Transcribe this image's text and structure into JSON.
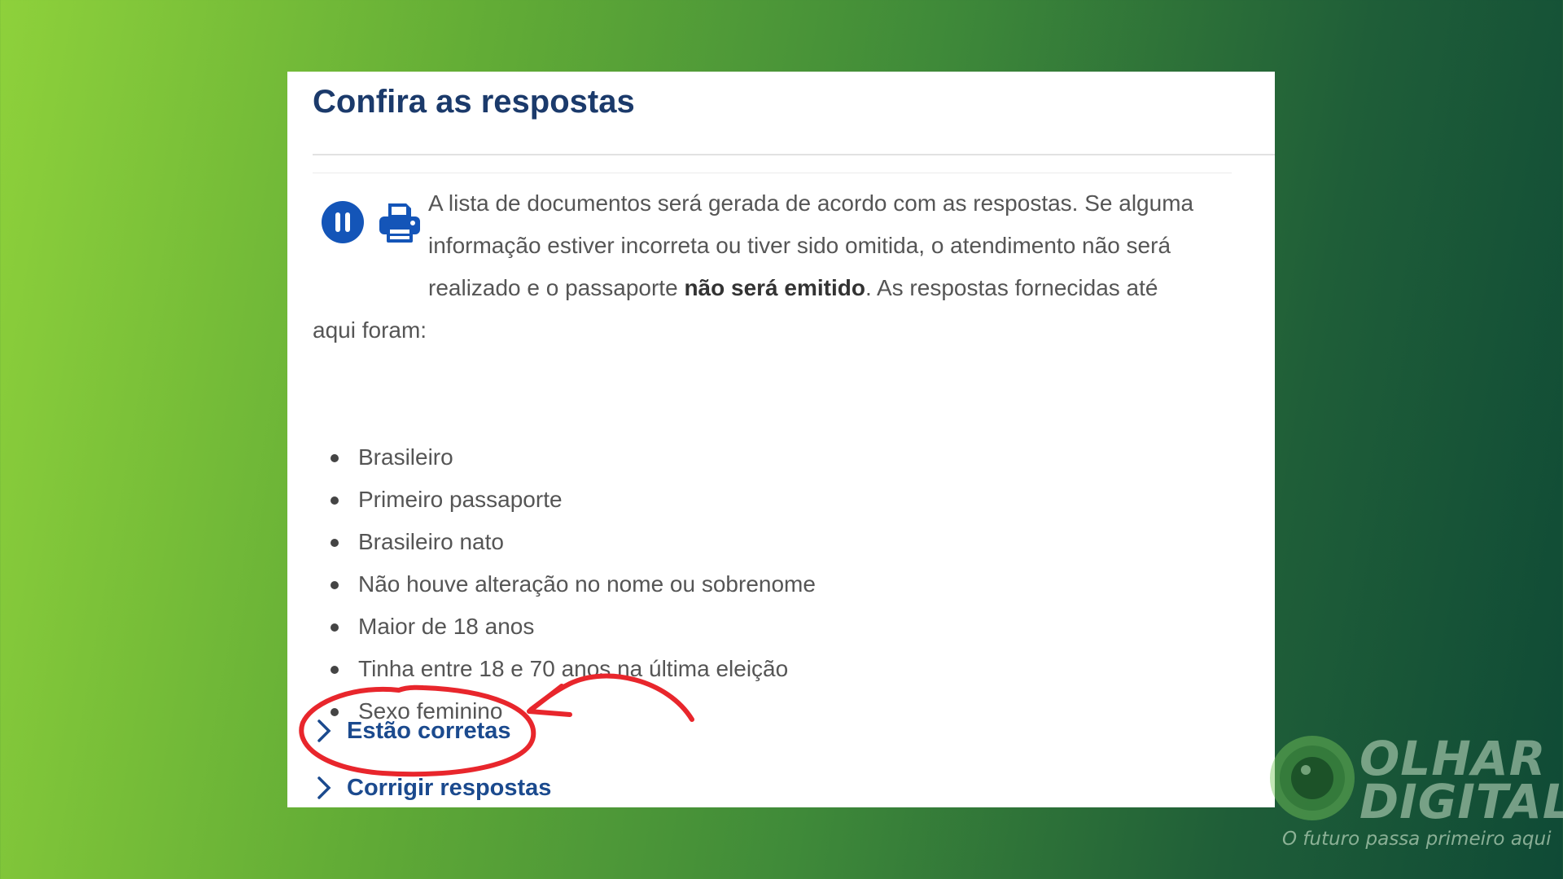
{
  "card": {
    "title": "Confira as respostas",
    "toolbar": {
      "pause_icon": "pause-circle-icon",
      "print_icon": "printer-icon"
    },
    "intro_before": "A lista de documentos será gerada de acordo com as respostas. Se alguma informação estiver incorreta ou tiver sido omitida, o atendimento não será realizado e o passaporte ",
    "intro_bold": "não será emitido",
    "intro_after": ". As respostas fornecidas até aqui foram:",
    "answers": [
      "Brasileiro",
      "Primeiro passaporte",
      "Brasileiro nato",
      "Não houve alteração no nome ou sobrenome",
      "Maior de 18 anos",
      "Tinha entre 18 e 70 anos na última eleição",
      "Sexo feminino"
    ],
    "actions": {
      "confirm_label": "Estão corretas",
      "correct_label": "Corrigir respostas"
    }
  },
  "colors": {
    "title": "#1b3a6b",
    "link": "#1b4a8e",
    "icon": "#1455b8",
    "annotation": "#e8262c"
  },
  "watermark": {
    "brand_line1": "OLHAR",
    "brand_line2": "DIGITAL",
    "tagline": "O futuro passa primeiro aqui"
  }
}
